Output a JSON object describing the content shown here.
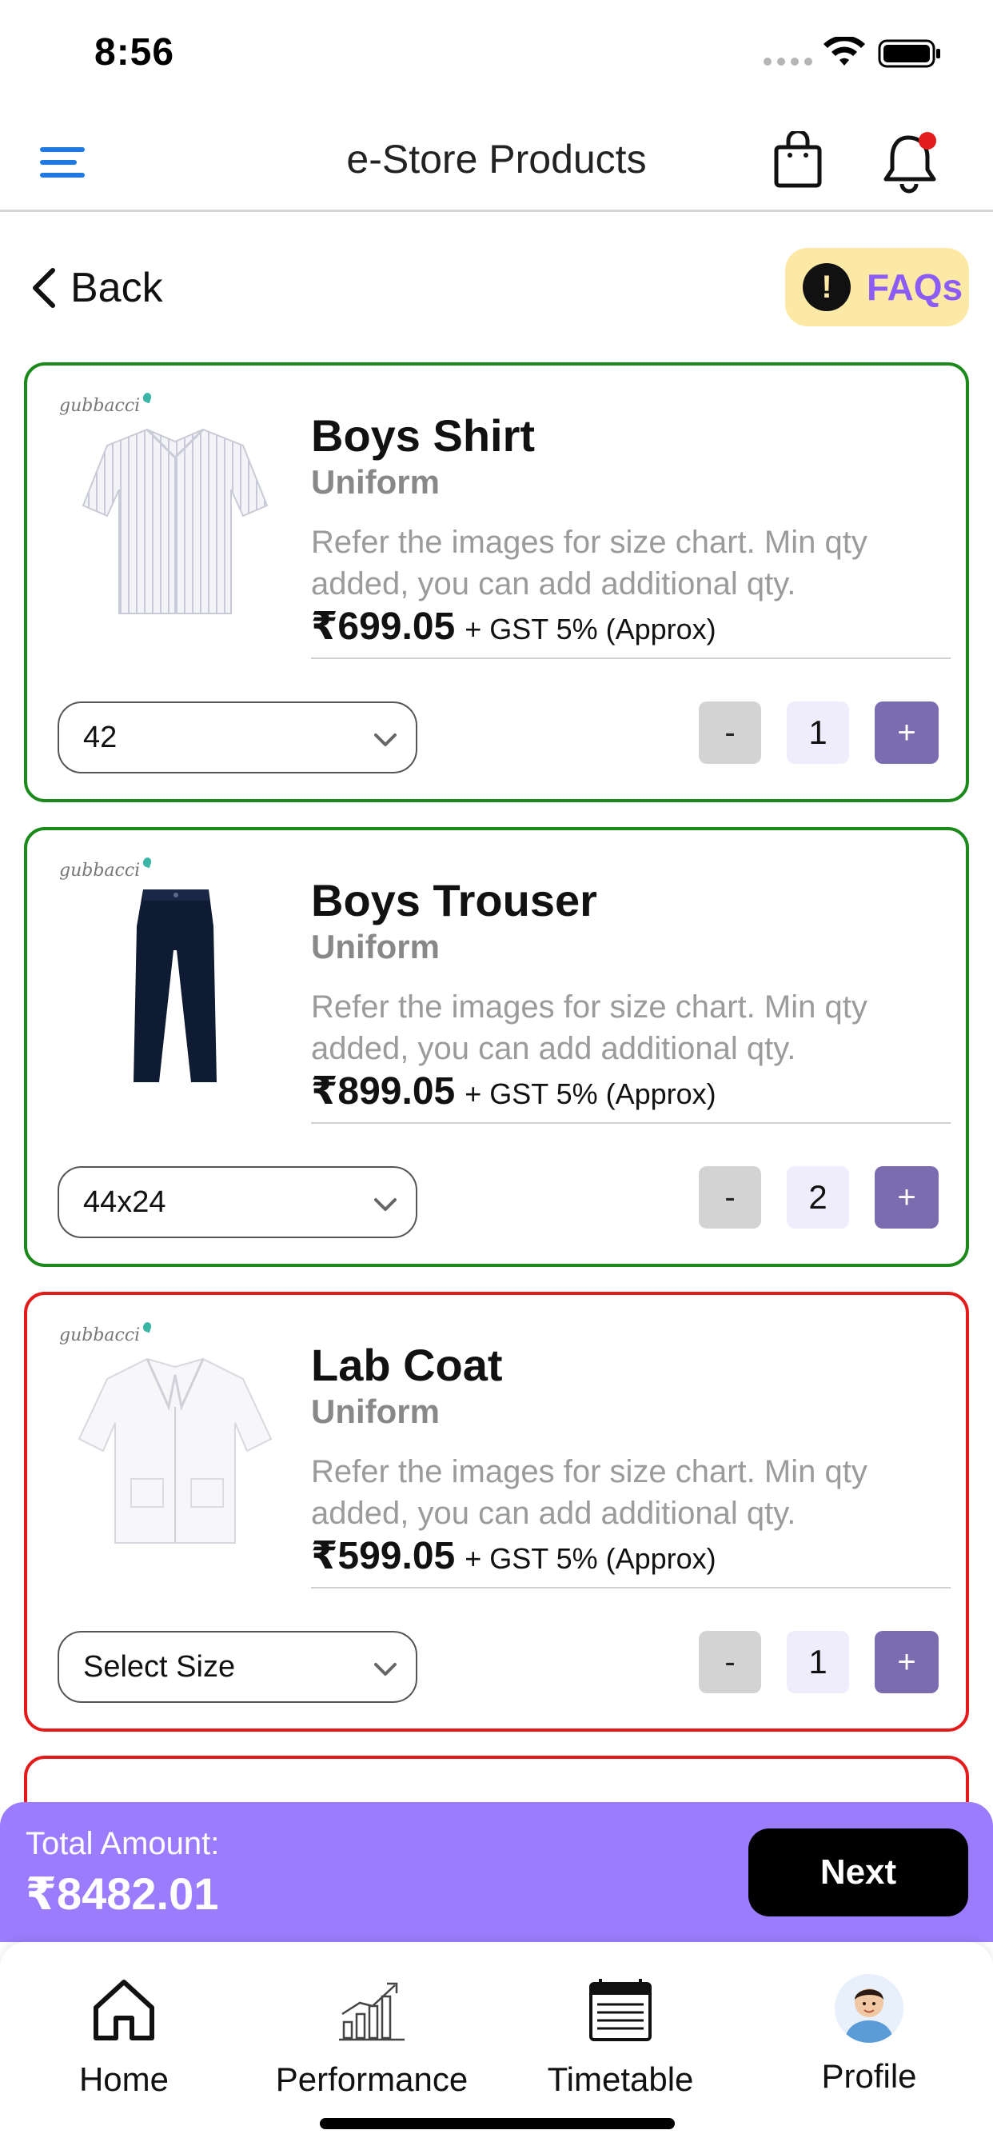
{
  "status_bar": {
    "time": "8:56"
  },
  "header": {
    "title": "e-Store Products"
  },
  "nav": {
    "back_label": "Back",
    "faq_label": "FAQs"
  },
  "products": [
    {
      "name": "Boys Shirt",
      "category": "Uniform",
      "description": "Refer the images for size chart. Min qty added, you can add additional qty.",
      "price": "₹699.05",
      "gst": "+ GST 5% (Approx)",
      "size": "42",
      "qty_minus": "-",
      "qty": "1",
      "qty_plus": "+",
      "status": "complete",
      "image_icon": "shirt-icon"
    },
    {
      "name": "Boys Trouser",
      "category": "Uniform",
      "description": "Refer the images for size chart. Min qty added, you can add additional qty.",
      "price": "₹899.05",
      "gst": "+ GST 5% (Approx)",
      "size": "44x24",
      "qty_minus": "-",
      "qty": "2",
      "qty_plus": "+",
      "status": "complete",
      "image_icon": "trouser-icon"
    },
    {
      "name": "Lab Coat",
      "category": "Uniform",
      "description": "Refer the images for size chart. Min qty added, you can add additional qty.",
      "price": "₹599.05",
      "gst": "+ GST 5% (Approx)",
      "size": "Select Size",
      "qty_minus": "-",
      "qty": "1",
      "qty_plus": "+",
      "status": "incomplete",
      "image_icon": "lab-coat-icon"
    }
  ],
  "brand": {
    "logo_text": "gubbacci"
  },
  "total": {
    "label": "Total Amount:",
    "amount": "₹8482.01",
    "next_label": "Next"
  },
  "tabs": [
    {
      "label": "Home",
      "icon": "home-icon"
    },
    {
      "label": "Performance",
      "icon": "performance-chart-icon"
    },
    {
      "label": "Timetable",
      "icon": "calendar-icon"
    },
    {
      "label": "Profile",
      "icon": "avatar"
    }
  ],
  "colors": {
    "complete_border": "#1b8a1b",
    "incomplete_border": "#e41b1b",
    "accent": "#9b7cfd",
    "qty_plus": "#7b6baf",
    "faq_bg": "#fde9a6",
    "notification_dot": "#e41b1b"
  }
}
